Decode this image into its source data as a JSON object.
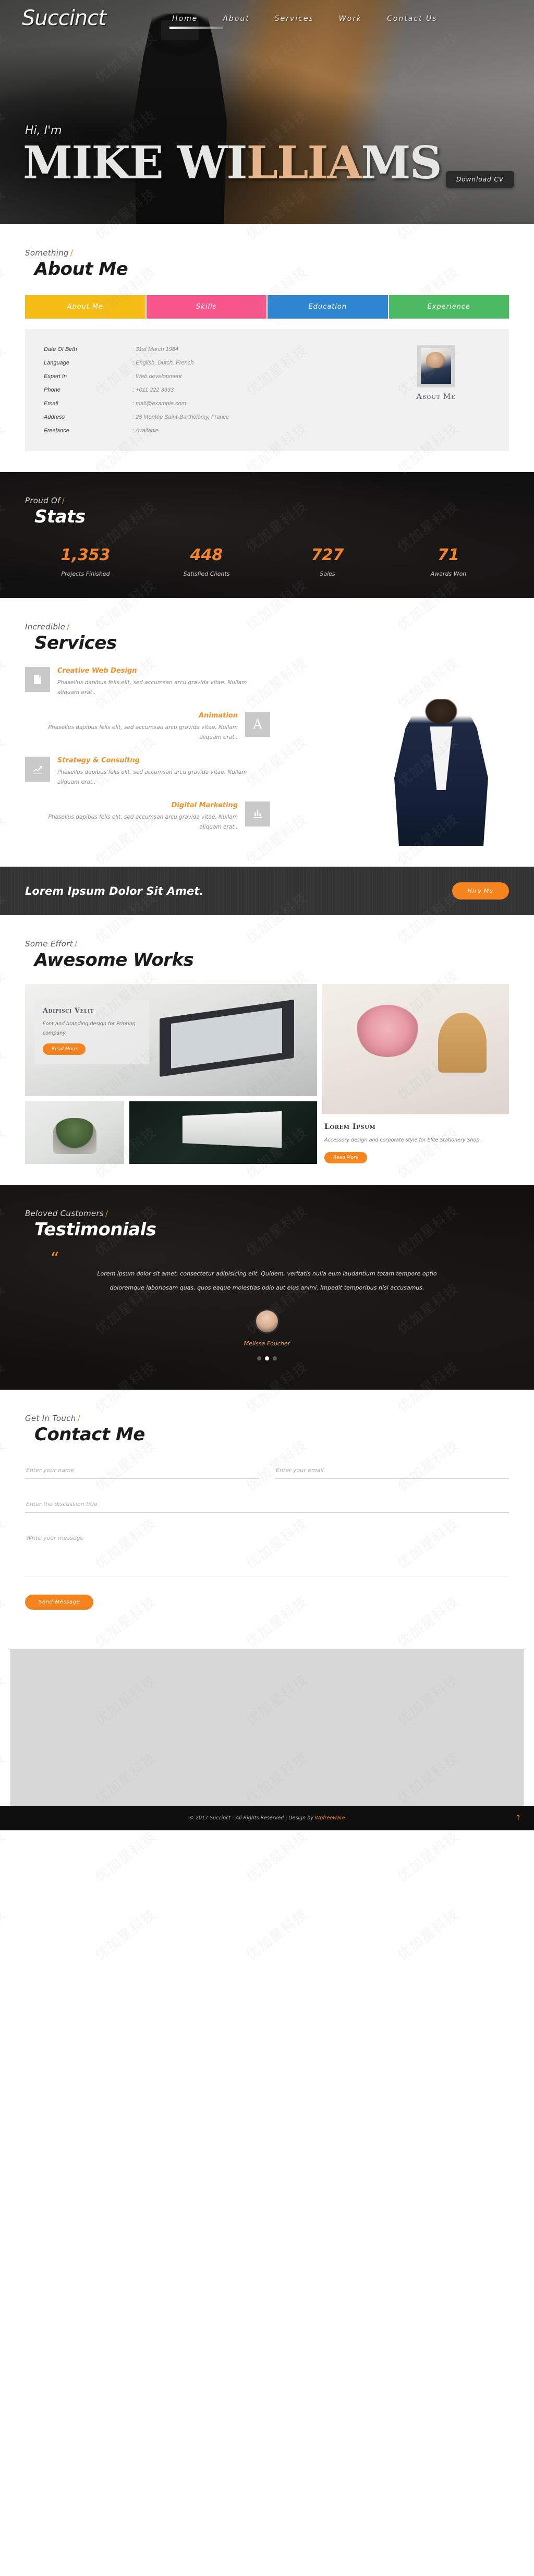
{
  "site": {
    "logo": "Succinct"
  },
  "nav": [
    {
      "label": "Home",
      "active": true
    },
    {
      "label": "About",
      "active": false
    },
    {
      "label": "Services",
      "active": false
    },
    {
      "label": "Work",
      "active": false
    },
    {
      "label": "Contact Us",
      "active": false
    }
  ],
  "hero": {
    "greeting": "Hi, I'm",
    "name_white": "MIKE WI",
    "name_orange": "LLIA",
    "name_white2": "MS",
    "cta_label": "Download CV"
  },
  "about": {
    "eyebrow": "Something",
    "title": "About Me",
    "tabs": [
      {
        "label": "About Me",
        "color": "#f5bc16"
      },
      {
        "label": "Skills",
        "color": "#f7568c"
      },
      {
        "label": "Education",
        "color": "#2f86d0"
      },
      {
        "label": "Experience",
        "color": "#4cb963"
      }
    ],
    "rows": [
      {
        "key": "Date Of Birth",
        "value": ": 31st March 1984"
      },
      {
        "key": "Language",
        "value": ": English, Dutch, French"
      },
      {
        "key": "Expert In",
        "value": ": Web development"
      },
      {
        "key": "Phone",
        "value": ": +011 222 3333"
      },
      {
        "key": "Email",
        "value": ": mail@example.com"
      },
      {
        "key": "Address",
        "value": ": 25 Montée Saint-Barthélémy, France"
      },
      {
        "key": "Freelance",
        "value": ": Available"
      }
    ],
    "photo_caption": "About Me"
  },
  "stats": {
    "eyebrow": "Proud Of",
    "title": "Stats",
    "accent": "#f3822c",
    "items": [
      {
        "number": "1,353",
        "label": "Projects Finished"
      },
      {
        "number": "448",
        "label": "Satisfied Clients"
      },
      {
        "number": "727",
        "label": "Sales"
      },
      {
        "number": "71",
        "label": "Awards Won"
      }
    ]
  },
  "services": {
    "eyebrow": "Incredible",
    "title": "Services",
    "items": [
      {
        "title": "Creative Web Design",
        "desc": "Phasellus dapibus felis elit, sed accumsan arcu gravida vitae. Nullam aliquam erat..",
        "icon": "image-icon",
        "align": "left"
      },
      {
        "title": "Animation",
        "desc": "Phasellus dapibus felis elit, sed accumsan arcu gravida vitae. Nullam aliquam erat..",
        "icon": "letter-a-icon",
        "align": "right"
      },
      {
        "title": "Strategy & Consultng",
        "desc": "Phasellus dapibus felis elit, sed accumsan arcu gravida vitae. Nullam aliquam erat..",
        "icon": "chart-line-icon",
        "align": "left"
      },
      {
        "title": "Digital Marketing",
        "desc": "Phasellus dapibus felis elit, sed accumsan arcu gravida vitae. Nullam aliquam erat..",
        "icon": "bar-chart-icon",
        "align": "right"
      }
    ]
  },
  "cta": {
    "headline": "Lorem Ipsum Dolor Sit Amet.",
    "button": "Hire Me",
    "accent": "#f5841f"
  },
  "works": {
    "eyebrow": "Some Effort",
    "title": "Awesome Works",
    "card1": {
      "title": "Adipisci Velit",
      "desc": "Font and branding design for Printing company.",
      "button": "Read More"
    },
    "card2": {
      "title": "Lorem Ipsum",
      "desc": "Accessory design and corporate style for Elite Stationery Shop.",
      "button": "Read More"
    }
  },
  "testimonials": {
    "eyebrow": "Beloved Customers",
    "title": "Testimonials",
    "quote_icon": "“",
    "quote": "Lorem ipsum dolor sit amet, consectetur adipisicing elit. Quidem, veritatis nulla eum laudantium totam tempore optio doloremque laboriosam quas, quos eaque molestias odio aut eius animi. Impedit temporibus nisi accusamus.",
    "author": "Melissa Foucher",
    "slide_count": 3,
    "active_slide": 2
  },
  "contact": {
    "eyebrow": "Get In Touch",
    "title": "Contact Me",
    "name_placeholder": "Enter your name",
    "email_placeholder": "Enter your email",
    "subject_placeholder": "Enter the discussion title",
    "message_placeholder": "Write your message",
    "submit_label": "Send Message"
  },
  "footer": {
    "text": "© 2017 Succinct - All Rights Reserved | Design by",
    "link": "Wpfreeware",
    "totop_icon": "↑"
  },
  "watermark": {
    "text": "优加星科技"
  }
}
